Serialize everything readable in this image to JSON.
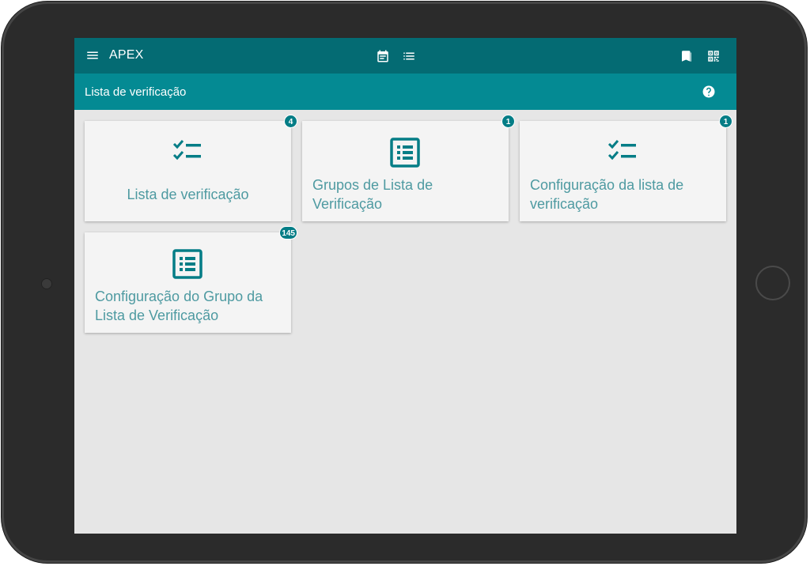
{
  "header": {
    "app_title": "APEX",
    "icons": [
      "menu-icon",
      "calendar-icon",
      "list-icon",
      "bookmark-icon",
      "qr-code-icon"
    ]
  },
  "subheader": {
    "title": "Lista de verificação",
    "help_icon": "help-icon"
  },
  "cards": [
    {
      "label": "Lista de verificação",
      "badge": "4",
      "icon": "checklist-icon"
    },
    {
      "label": "Grupos de Lista de Verificação",
      "badge": "1",
      "icon": "list-box-icon"
    },
    {
      "label": "Configuração da lista de verificação",
      "badge": "1",
      "icon": "checklist-icon"
    },
    {
      "label": "Configuração do Grupo da Lista de Verificação",
      "badge": "145",
      "icon": "list-box-icon"
    }
  ],
  "colors": {
    "topbar": "#046b73",
    "subbar": "#048a93",
    "card_text": "#4e9aa1",
    "badge": "#047d86"
  }
}
